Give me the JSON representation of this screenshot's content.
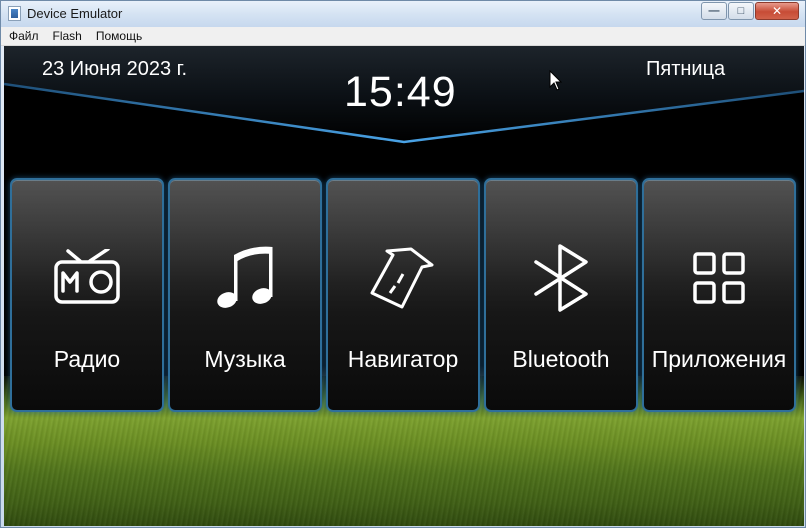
{
  "window": {
    "title": "Device Emulator",
    "icon": "app-window-icon",
    "controls": [
      "minimize-icon",
      "maximize-icon",
      "close-icon"
    ]
  },
  "menubar": {
    "items": [
      "Файл",
      "Flash",
      "Помощь"
    ]
  },
  "statusbar": {
    "date": "23 Июня 2023 г.",
    "time": "15:49",
    "day": "Пятница"
  },
  "tiles": [
    {
      "label": "Радио",
      "icon": "radio-icon"
    },
    {
      "label": "Музыка",
      "icon": "music-note-icon"
    },
    {
      "label": "Навигатор",
      "icon": "navigation-arrow-icon"
    },
    {
      "label": "Bluetooth",
      "icon": "bluetooth-icon"
    },
    {
      "label": "Приложения",
      "icon": "apps-grid-icon"
    }
  ],
  "colors": {
    "tile_border": "#2f6f9a",
    "band_highlight": "#3d8ed0",
    "background": "#000000"
  }
}
